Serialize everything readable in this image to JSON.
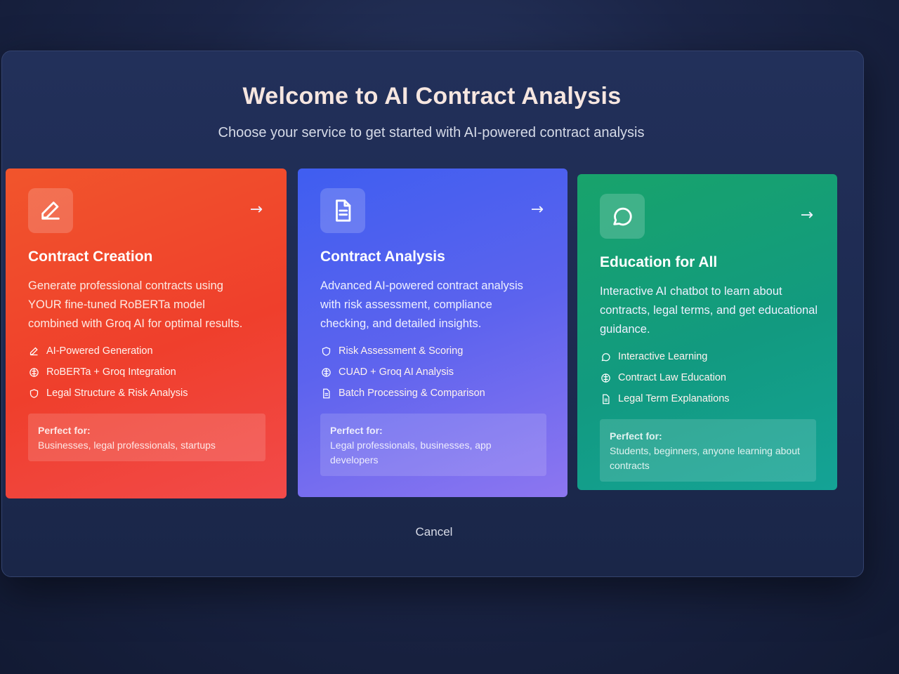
{
  "header": {
    "title": "Welcome to AI Contract Analysis",
    "subtitle": "Choose your service to get started with AI-powered contract analysis"
  },
  "cards": [
    {
      "title": "Contract Creation",
      "description": "Generate professional contracts using YOUR fine-tuned RoBERTa model combined with Groq AI for optimal results.",
      "icon": "pen-icon",
      "color": "#ef4a2c",
      "features": [
        {
          "icon": "pen-icon",
          "label": "AI-Powered Generation"
        },
        {
          "icon": "brain-icon",
          "label": "RoBERTa + Groq Integration"
        },
        {
          "icon": "shield-icon",
          "label": "Legal Structure & Risk Analysis"
        }
      ],
      "perfect_label": "Perfect for:",
      "perfect_text": "Businesses, legal professionals, startups"
    },
    {
      "title": "Contract Analysis",
      "description": "Advanced AI-powered contract analysis with risk assessment, compliance checking, and detailed insights.",
      "icon": "document-icon",
      "color": "#4f60ef",
      "features": [
        {
          "icon": "shield-icon",
          "label": "Risk Assessment & Scoring"
        },
        {
          "icon": "brain-icon",
          "label": "CUAD + Groq AI Analysis"
        },
        {
          "icon": "document-icon",
          "label": "Batch Processing & Comparison"
        }
      ],
      "perfect_label": "Perfect for:",
      "perfect_text": "Legal professionals, businesses, app developers"
    },
    {
      "title": "Education for All",
      "description": "Interactive AI chatbot to learn about contracts, legal terms, and get educational guidance.",
      "icon": "chat-icon",
      "color": "#15a07a",
      "features": [
        {
          "icon": "chat-icon",
          "label": "Interactive Learning"
        },
        {
          "icon": "brain-icon",
          "label": "Contract Law Education"
        },
        {
          "icon": "document-icon",
          "label": "Legal Term Explanations"
        }
      ],
      "perfect_label": "Perfect for:",
      "perfect_text": "Students, beginners, anyone learning about contracts"
    }
  ],
  "footer": {
    "cancel_label": "Cancel"
  }
}
